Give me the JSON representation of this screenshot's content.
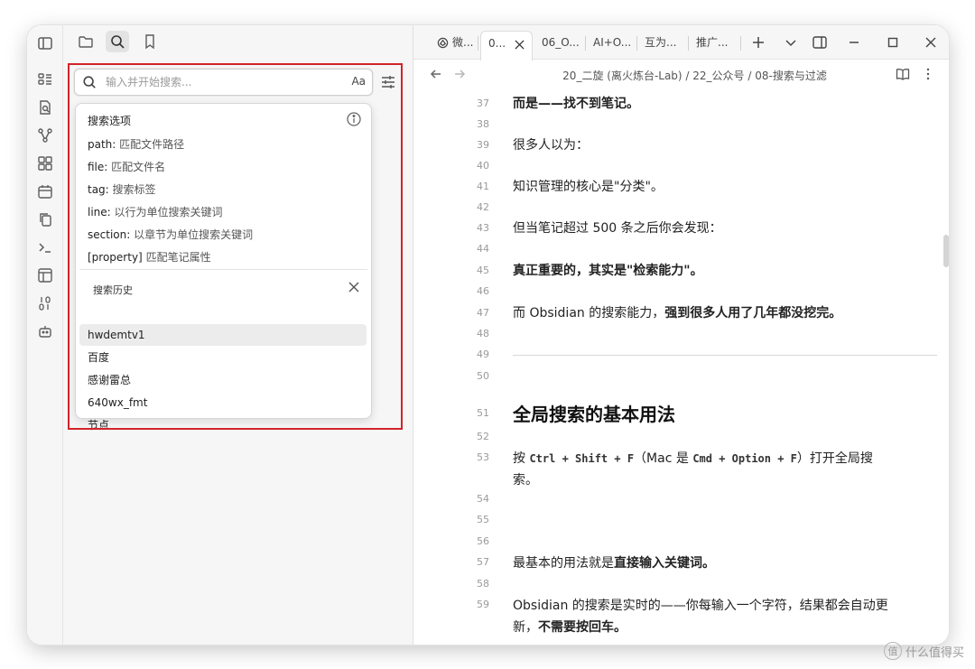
{
  "sidebar": {
    "search": {
      "placeholder": "输入并开始搜索...",
      "case_toggle": "Aa"
    },
    "options": {
      "heading": "搜索选项",
      "items": [
        {
          "key": "path:",
          "desc": "匹配文件路径"
        },
        {
          "key": "file:",
          "desc": "匹配文件名"
        },
        {
          "key": "tag:",
          "desc": "搜索标签"
        },
        {
          "key": "line:",
          "desc": "以行为单位搜索关键词"
        },
        {
          "key": "section:",
          "desc": "以章节为单位搜索关键词"
        },
        {
          "key": "[property]",
          "desc": "匹配笔记属性"
        }
      ]
    },
    "history": {
      "heading": "搜索历史",
      "items": [
        "hwdemtv1",
        "百度",
        "感谢雷总",
        "640wx_fmt",
        "节点"
      ]
    }
  },
  "tabs": [
    "微...",
    "0...",
    "06_O...",
    "AI+O...",
    "互为...",
    "推广..."
  ],
  "breadcrumb": "20_二旋 (离火炼台-Lab) / 22_公众号 / 08-搜索与过滤",
  "editor": {
    "l37": "37",
    "t37": "而是——找不到笔记。",
    "l38": "38",
    "l39": "39",
    "t39": "很多人以为：",
    "l40": "40",
    "l41": "41",
    "t41": "知识管理的核心是\"分类\"。",
    "l42": "42",
    "l43": "43",
    "t43": "但当笔记超过 500 条之后你会发现：",
    "l44": "44",
    "l45": "45",
    "t45": "真正重要的，其实是\"检索能力\"。",
    "l46": "46",
    "l47": "47",
    "t47a": "而 Obsidian 的搜索能力，",
    "t47b": "强到很多人用了几年都没挖完。",
    "l48": "48",
    "l49": "49",
    "l50": "50",
    "l51": "51",
    "t51": "全局搜索的基本用法",
    "l52": "52",
    "l53": "53",
    "t53a": "按 ",
    "t53code1": "Ctrl + Shift + F",
    "t53b": "（Mac 是 ",
    "t53code2": "Cmd + Option + F",
    "t53c": "）打开全局搜",
    "t53d": "索。",
    "l54": "54",
    "l55": "55",
    "l56": "56",
    "l57": "57",
    "t57a": "最基本的用法就是",
    "t57b": "直接输入关键词。",
    "l58": "58",
    "l59": "59",
    "t59a": "Obsidian 的搜索是实时的——你每输入一个字符，结果都会自动更",
    "t59b": "新，",
    "t59c": "不需要按回车。"
  },
  "watermark": "什么值得买",
  "watermark_logo": "值"
}
